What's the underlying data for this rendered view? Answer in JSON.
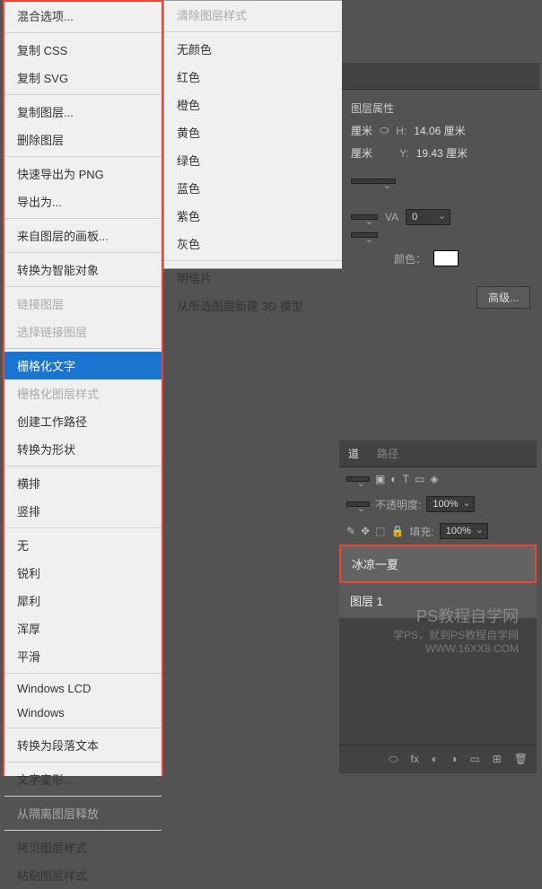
{
  "menu1": {
    "items": [
      {
        "label": "混合选项...",
        "type": "item"
      },
      {
        "type": "sep"
      },
      {
        "label": "复制 CSS",
        "type": "item"
      },
      {
        "label": "复制 SVG",
        "type": "item"
      },
      {
        "type": "sep"
      },
      {
        "label": "复制图层...",
        "type": "item"
      },
      {
        "label": "删除图层",
        "type": "item"
      },
      {
        "type": "sep"
      },
      {
        "label": "快速导出为 PNG",
        "type": "item"
      },
      {
        "label": "导出为...",
        "type": "item"
      },
      {
        "type": "sep"
      },
      {
        "label": "来自图层的画板...",
        "type": "item"
      },
      {
        "type": "sep"
      },
      {
        "label": "转换为智能对象",
        "type": "item"
      },
      {
        "type": "sep"
      },
      {
        "label": "链接图层",
        "type": "item",
        "disabled": true
      },
      {
        "label": "选择链接图层",
        "type": "item",
        "disabled": true
      },
      {
        "type": "sep"
      },
      {
        "label": "栅格化文字",
        "type": "item",
        "selected": true
      },
      {
        "label": "栅格化图层样式",
        "type": "item",
        "disabled": true
      },
      {
        "label": "创建工作路径",
        "type": "item"
      },
      {
        "label": "转换为形状",
        "type": "item"
      },
      {
        "type": "sep"
      },
      {
        "label": "横排",
        "type": "item"
      },
      {
        "label": "竖排",
        "type": "item"
      },
      {
        "type": "sep"
      },
      {
        "label": "无",
        "type": "item"
      },
      {
        "label": "锐利",
        "type": "item"
      },
      {
        "label": "犀利",
        "type": "item"
      },
      {
        "label": "浑厚",
        "type": "item"
      },
      {
        "label": "平滑",
        "type": "item"
      },
      {
        "type": "sep"
      },
      {
        "label": "Windows LCD",
        "type": "item"
      },
      {
        "label": "Windows",
        "type": "item"
      },
      {
        "type": "sep"
      },
      {
        "label": "转换为段落文本",
        "type": "item"
      },
      {
        "type": "sep"
      },
      {
        "label": "文字变形...",
        "type": "item"
      },
      {
        "type": "sep"
      },
      {
        "label": "从隔离图层释放",
        "type": "item",
        "disabled": true
      },
      {
        "type": "sep"
      },
      {
        "label": "拷贝图层样式",
        "type": "item"
      },
      {
        "label": "粘贴图层样式",
        "type": "item"
      }
    ]
  },
  "menu2": {
    "items": [
      {
        "label": "清除图层样式",
        "type": "item",
        "disabled": true
      },
      {
        "type": "sep"
      },
      {
        "label": "无颜色",
        "type": "item"
      },
      {
        "label": "红色",
        "type": "item"
      },
      {
        "label": "橙色",
        "type": "item"
      },
      {
        "label": "黄色",
        "type": "item"
      },
      {
        "label": "绿色",
        "type": "item"
      },
      {
        "label": "蓝色",
        "type": "item"
      },
      {
        "label": "紫色",
        "type": "item"
      },
      {
        "label": "灰色",
        "type": "item"
      },
      {
        "type": "sep"
      },
      {
        "label": "明信片",
        "type": "item"
      },
      {
        "label": "从所选图层新建 3D 模型",
        "type": "item"
      }
    ]
  },
  "properties": {
    "title": "图层属性",
    "h_label": "H:",
    "h_value": "14.06 厘米",
    "y_label": "Y:",
    "y_value": "19.43 厘米",
    "unit": "厘米",
    "va_label": "VA",
    "va_value": "0",
    "color_label": "颜色：",
    "advanced_btn": "高级..."
  },
  "layers": {
    "tab_active": "道",
    "tab_paths": "路径",
    "opacity_label": "不透明度:",
    "opacity_value": "100%",
    "fill_label": "填充:",
    "fill_value": "100%",
    "layer1_name": "冰凉一夏",
    "layer2_name": "图层 1"
  },
  "watermark": {
    "title": "PS教程自学网",
    "line1": "学PS，就到PS教程自学网",
    "line2": "WWW.16XX8.COM"
  },
  "icons": {
    "link": "⬭",
    "fx": "fx",
    "mask": "◐",
    "adj": "◑",
    "folder": "▭",
    "new": "⊞",
    "trash": "🗑"
  }
}
